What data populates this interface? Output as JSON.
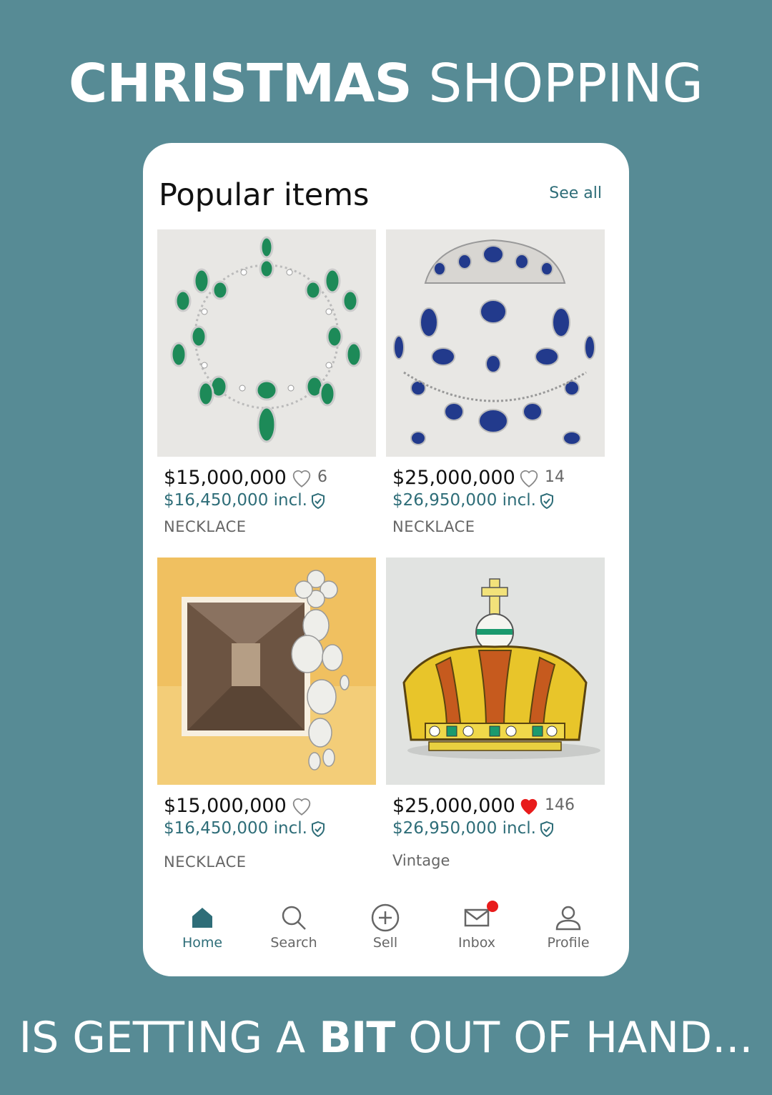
{
  "headline": {
    "top_bold": "CHRISTMAS",
    "top_light": "SHOPPING",
    "bottom_pre": "IS GETTING A ",
    "bottom_bold": "BIT",
    "bottom_post": " OUT OF HAND..."
  },
  "section": {
    "title": "Popular items",
    "see_all": "See all"
  },
  "items": [
    {
      "price": "$15,000,000",
      "likes": "6",
      "liked": false,
      "incl_price": "$16,450,000 incl.",
      "category": "NECKLACE",
      "image": "emerald-necklace"
    },
    {
      "price": "$25,000,000",
      "likes": "14",
      "liked": false,
      "incl_price": "$26,950,000 incl.",
      "category": "NECKLACE",
      "image": "sapphire-parure"
    },
    {
      "price": "$15,000,000",
      "likes": "",
      "liked": false,
      "incl_price": "$16,450,000 incl.",
      "category": "NECKLACE",
      "image": "diamond-brooch-gallery"
    },
    {
      "price": "$25,000,000",
      "likes": "146",
      "liked": true,
      "incl_price": "$26,950,000 incl.",
      "category": "Vintage",
      "image": "gold-crown"
    }
  ],
  "nav": [
    {
      "label": "Home",
      "icon": "home-icon",
      "active": true
    },
    {
      "label": "Search",
      "icon": "search-icon",
      "active": false
    },
    {
      "label": "Sell",
      "icon": "plus-circle-icon",
      "active": false
    },
    {
      "label": "Inbox",
      "icon": "mail-icon",
      "active": false,
      "badge": true
    },
    {
      "label": "Profile",
      "icon": "profile-icon",
      "active": false
    }
  ],
  "colors": {
    "background": "#578b95",
    "accent": "#2e6d78",
    "liked_heart": "#e81b1b",
    "badge": "#e81b1b"
  }
}
